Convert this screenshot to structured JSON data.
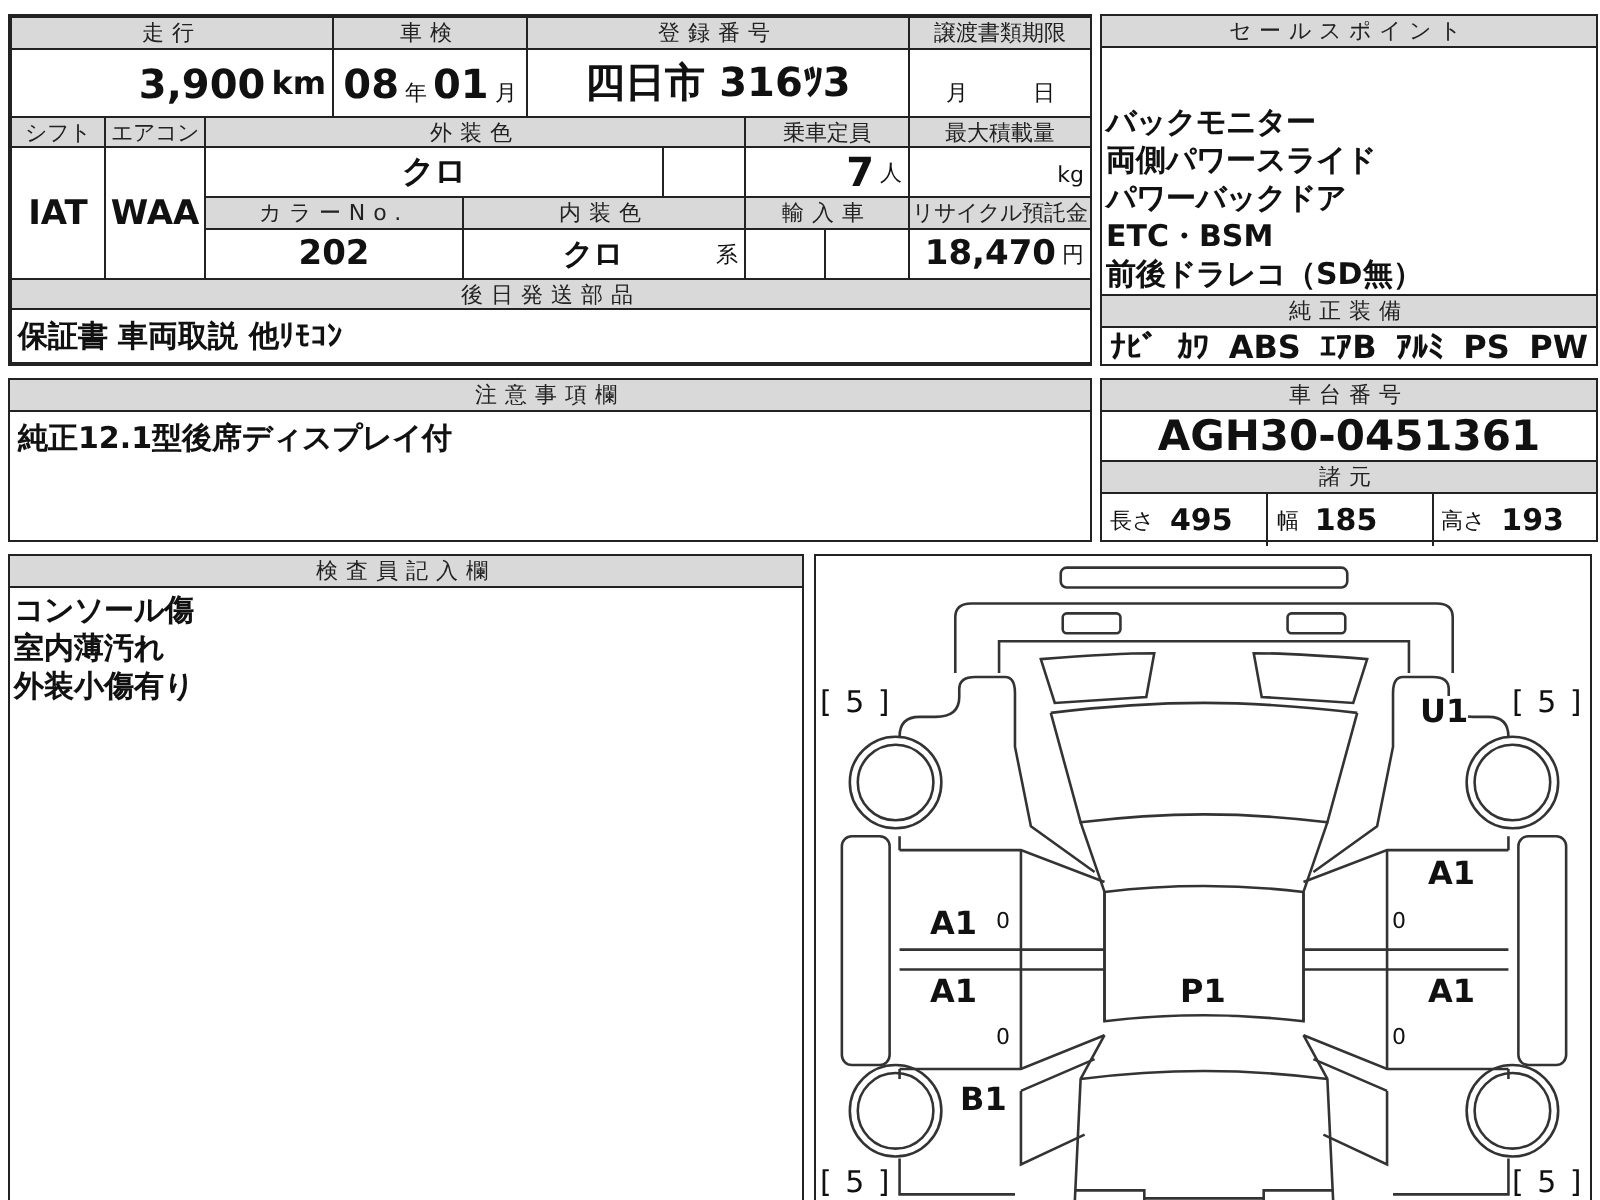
{
  "vehicle_table": {
    "mileage": {
      "label": "走行",
      "value": "3,900",
      "unit": "km"
    },
    "inspection": {
      "label": "車検",
      "year": "08",
      "year_unit": "年",
      "month": "01",
      "month_unit": "月"
    },
    "registration": {
      "label": "登録番号",
      "value": "四日市 316ﾂ3"
    },
    "transfer_deadline": {
      "label": "譲渡書類期限",
      "month_unit": "月",
      "day_unit": "日"
    },
    "shift": {
      "label": "シフト",
      "value": "IAT"
    },
    "aircon": {
      "label": "エアコン",
      "value": "WAA"
    },
    "exterior_color": {
      "label": "外装色",
      "value": "クロ"
    },
    "capacity": {
      "label": "乗車定員",
      "value": "7",
      "unit": "人"
    },
    "max_load": {
      "label": "最大積載量",
      "unit": "kg"
    },
    "color_no": {
      "label": "カラーNo.",
      "value": "202"
    },
    "interior_color": {
      "label": "内装色",
      "value": "クロ",
      "unit": "系"
    },
    "import": {
      "label": "輸入車"
    },
    "recycle_fee": {
      "label": "リサイクル預託金",
      "value": "18,470",
      "unit": "円"
    },
    "later_parts": {
      "label": "後日発送部品",
      "value": "保証書 車両取説 他ﾘﾓｺﾝ"
    }
  },
  "sales_points": {
    "label": "セールスポイント",
    "lines": [
      "バックモニター",
      "両側パワースライド",
      "パワーバックドア",
      "ETC・BSM",
      "前後ドラレコ（SD無）"
    ]
  },
  "equipment": {
    "label": "純正装備",
    "items": [
      "ﾅﾋﾞ",
      "ｶﾜ",
      "ABS",
      "ｴｱB",
      "ｱﾙﾐ",
      "PS",
      "PW"
    ]
  },
  "notes": {
    "label": "注意事項欄",
    "text": "純正12.1型後席ディスプレイ付"
  },
  "chassis": {
    "label": "車台番号",
    "value": "AGH30-0451361"
  },
  "specs": {
    "label": "諸元",
    "items": [
      {
        "label": "長さ",
        "value": "495"
      },
      {
        "label": "幅",
        "value": "185"
      },
      {
        "label": "高さ",
        "value": "193"
      }
    ]
  },
  "inspector": {
    "label": "検査員記入欄",
    "lines": [
      "コンソール傷",
      "室内薄汚れ",
      "外装小傷有り"
    ]
  },
  "diagram": {
    "corner_marks": [
      "[ 5 ]",
      "[ 5 ]",
      "[ 5 ]",
      "[ 5 ]"
    ],
    "marks": [
      "U1",
      "A1",
      "A1",
      "A1",
      "P1",
      "A1",
      "B1"
    ],
    "small_marks": [
      "0",
      "0",
      "0",
      "0"
    ]
  }
}
